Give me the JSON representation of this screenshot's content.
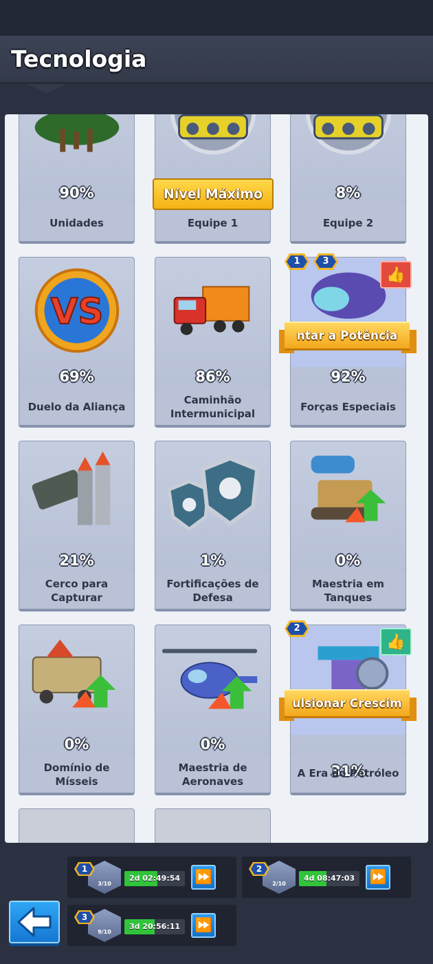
{
  "header": {
    "title": "Tecnologia"
  },
  "max_level_badge": "Nível Máximo",
  "cards": [
    {
      "name": "Unidades",
      "progress": "90%"
    },
    {
      "name": "Equipe 1",
      "progress": ""
    },
    {
      "name": "Equipe 2",
      "progress": "8%"
    },
    {
      "name": "Duelo da Aliança",
      "progress": "69%"
    },
    {
      "name": "Caminhão Intermunicipal",
      "progress": "86%"
    },
    {
      "name": "Forças Especiais",
      "progress": "92%"
    },
    {
      "name": "Cerco para Capturar",
      "progress": "21%"
    },
    {
      "name": "Fortificações de Defesa",
      "progress": "1%"
    },
    {
      "name": "Maestria em Tanques",
      "progress": "0%"
    },
    {
      "name": "Domínio de Mísseis",
      "progress": "0%"
    },
    {
      "name": "Maestria de Aeronaves",
      "progress": "0%"
    },
    {
      "name": "A Era do Petróleo",
      "progress": "31%"
    }
  ],
  "ribbons": {
    "forcas": "ntar a Potência",
    "era": "ulsionar Crescim"
  },
  "badges": {
    "forcas": [
      "1",
      "3"
    ],
    "era": [
      "2"
    ]
  },
  "queues": [
    {
      "level": "1",
      "count": "3/10",
      "timer": "2d 02:49:54",
      "fill": 0.55
    },
    {
      "level": "2",
      "count": "2/10",
      "timer": "4d 08:47:03",
      "fill": 0.45
    },
    {
      "level": "3",
      "count": "9/10",
      "timer": "3d 20:56:11",
      "fill": 0.5
    }
  ],
  "icons": {
    "back": "back-arrow-icon",
    "speedup": "fast-forward-icon",
    "like": "thumbs-up-icon"
  },
  "colors": {
    "panel": "#eef1f6",
    "card": "#c5cde0",
    "accent_gold": "#f3a81c",
    "accent_blue": "#1677d2",
    "progress_green": "#31c43a"
  }
}
